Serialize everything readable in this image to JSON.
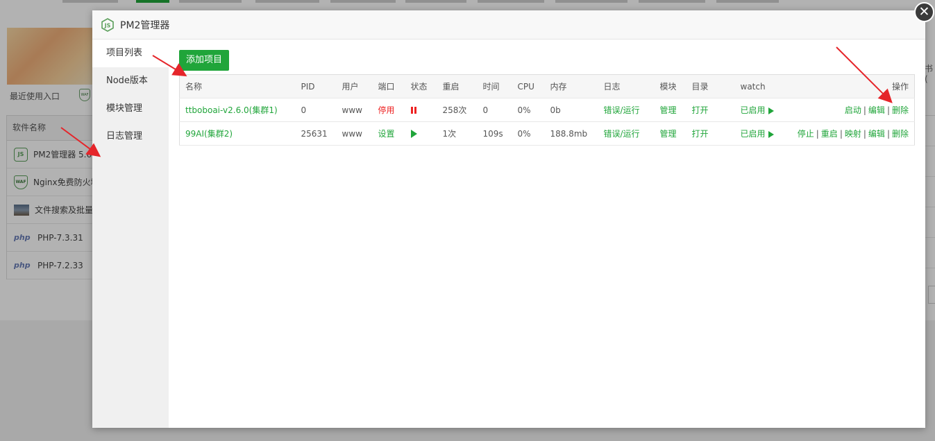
{
  "background": {
    "recent_label": "最近使用入口",
    "table_header": "软件名称",
    "rows": [
      {
        "icon": "node-icon",
        "label": "PM2管理器 5.6"
      },
      {
        "icon": "waf-icon",
        "label": "Nginx免费防火墙"
      },
      {
        "icon": "image-icon",
        "label": "文件搜索及批量替换"
      },
      {
        "icon": "php-icon",
        "label": "PHP-7.3.31"
      },
      {
        "icon": "php-icon",
        "label": "PHP-7.2.33"
      }
    ],
    "right_char": "书 ("
  },
  "modal": {
    "title": "PM2管理器",
    "close_symbol": "✕",
    "menu": [
      "项目列表",
      "Node版本",
      "模块管理",
      "日志管理"
    ],
    "add_button": "添加项目",
    "columns": [
      "名称",
      "PID",
      "用户",
      "端口",
      "状态",
      "重启",
      "时间",
      "CPU",
      "内存",
      "日志",
      "模块",
      "目录",
      "watch",
      "操作"
    ],
    "projects": [
      {
        "name": "ttboboai-v2.6.0(集群1)",
        "pid": "0",
        "user": "www",
        "port": "停用",
        "status": "paused",
        "restarts": "258次",
        "time": "0",
        "cpu": "0%",
        "memory": "0b",
        "log": "错误/运行",
        "module": "管理",
        "dir": "打开",
        "watch": "已启用",
        "actions": [
          "启动",
          "编辑",
          "删除"
        ]
      },
      {
        "name": "99AI(集群2)",
        "pid": "25631",
        "user": "www",
        "port": "设置",
        "status": "running",
        "restarts": "1次",
        "time": "109s",
        "cpu": "0%",
        "memory": "188.8mb",
        "log": "错误/运行",
        "module": "管理",
        "dir": "打开",
        "watch": "已启用",
        "actions": [
          "停止",
          "重启",
          "映射",
          "编辑",
          "删除"
        ]
      }
    ]
  },
  "colors": {
    "accent": "#20a53a",
    "danger": "#e22",
    "annotation_arrow": "#e5252a"
  }
}
